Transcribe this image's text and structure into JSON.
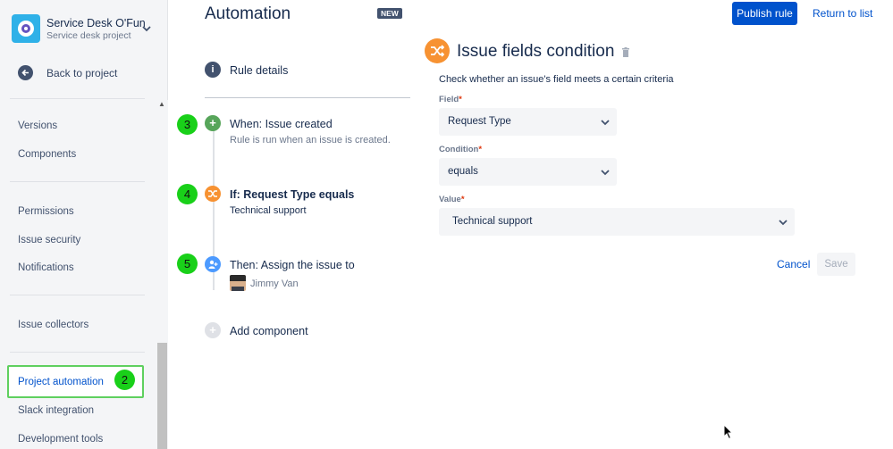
{
  "sidebar": {
    "project_name": "Service Desk O'Fun",
    "project_sub": "Service desk project",
    "back_label": "Back to project",
    "items": [
      {
        "label": "Versions"
      },
      {
        "label": "Components"
      },
      {
        "label": "Permissions"
      },
      {
        "label": "Issue security"
      },
      {
        "label": "Notifications"
      },
      {
        "label": "Issue collectors"
      },
      {
        "label": "Project automation"
      },
      {
        "label": "Slack integration"
      },
      {
        "label": "Development tools"
      }
    ]
  },
  "badges": {
    "b2": "2",
    "b3": "3",
    "b4": "4",
    "b5": "5"
  },
  "header": {
    "title": "Automation",
    "new_lozenge": "NEW",
    "publish_label": "Publish rule",
    "return_label": "Return to list"
  },
  "rule": {
    "details_label": "Rule details",
    "steps": [
      {
        "title": "When: Issue created",
        "sub": "Rule is run when an issue is created.",
        "icon_color": "#57a55a"
      },
      {
        "title": "If: Request Type equals",
        "sub": "Technical support",
        "icon_color": "#f79232"
      },
      {
        "title": "Then: Assign the issue to",
        "sub": "Jimmy Van",
        "icon_color": "#4c9aff"
      },
      {
        "title": "Add component",
        "sub": "",
        "icon_color": "#dfe1e6"
      }
    ]
  },
  "condition": {
    "title": "Issue fields condition",
    "description": "Check whether an issue's field meets a certain criteria",
    "field_label": "Field",
    "field_value": "Request Type",
    "condition_label": "Condition",
    "condition_value": "equals",
    "value_label": "Value",
    "value_value": "Technical support",
    "required_mark": "*",
    "cancel_label": "Cancel",
    "save_label": "Save"
  },
  "colors": {
    "accent": "#0052cc",
    "badge_green": "#19d019",
    "highlight_border": "#5fd05f",
    "condition_orange": "#f79232"
  }
}
